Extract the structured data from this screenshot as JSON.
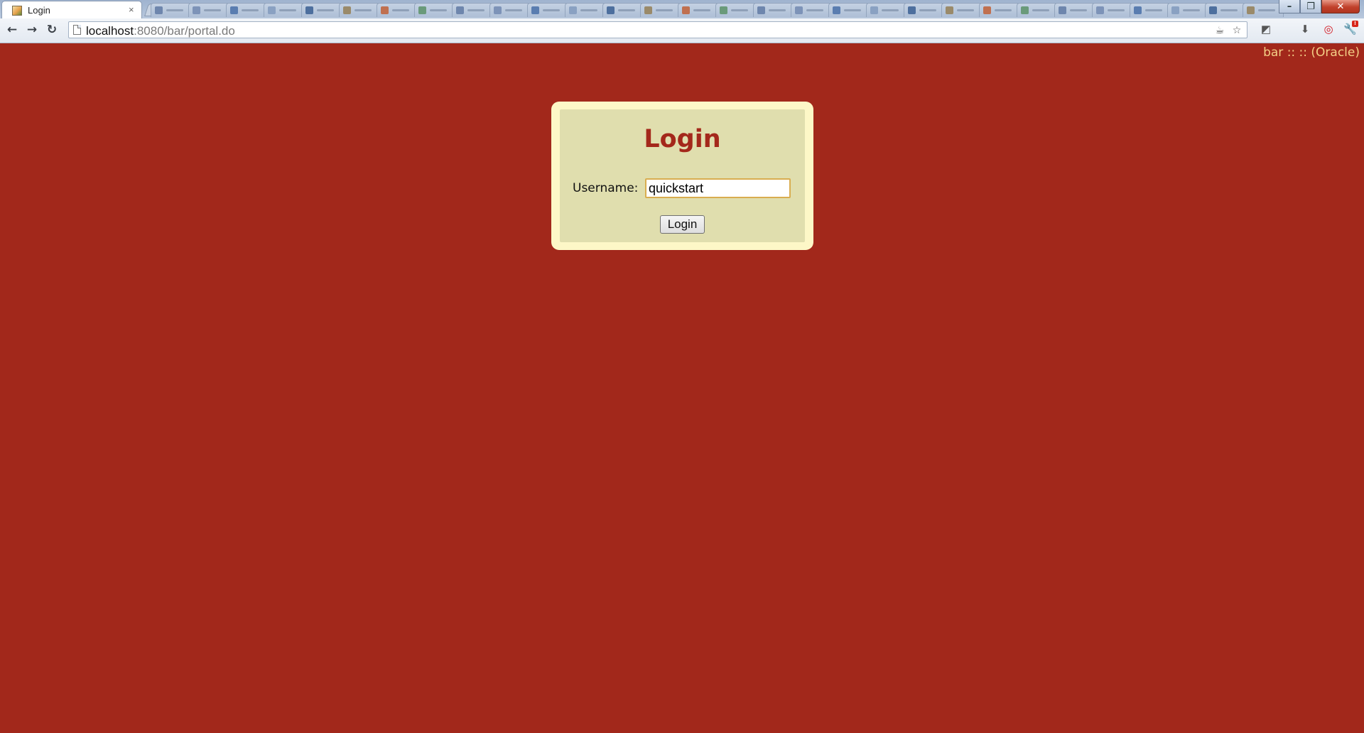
{
  "browser": {
    "tab_title": "Login",
    "tab_close": "×",
    "url_host": "localhost",
    "url_rest": ":8080/bar/portal.do",
    "window_buttons": {
      "minimize": "–",
      "restore": "❐",
      "close": "✕"
    },
    "nav": {
      "back": "←",
      "forward": "→",
      "reload": "↻"
    }
  },
  "header": {
    "db_info": "bar :: :: (Oracle)"
  },
  "login": {
    "title": "Login",
    "username_label": "Username:",
    "username_value": "quickstart",
    "button_label": "Login"
  },
  "colors": {
    "page_background": "#a2281b",
    "panel_outer": "#fdf7c7",
    "panel_inner": "#e0deae",
    "title": "#a4281b",
    "db_info_text": "#f4cf86",
    "input_border": "#d9ad50"
  }
}
